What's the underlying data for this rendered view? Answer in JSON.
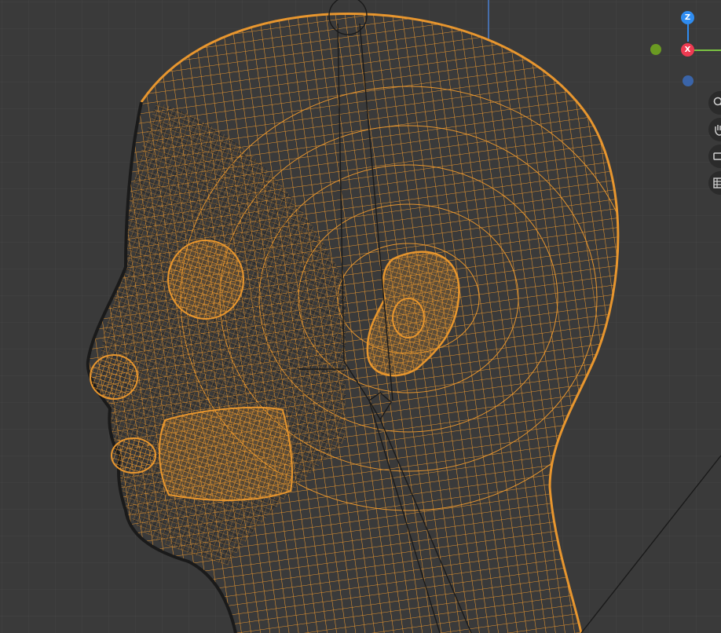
{
  "viewport": {
    "background_color": "#3a3a3a",
    "grid_color": "#464646",
    "wire_color": "#e8962e",
    "wire_dark_color": "#1e1e1e",
    "axis_line_color": "#4a7fd0"
  },
  "gizmo": {
    "z_label": "Z",
    "x_label": "X",
    "z_color": "#2f8cf0",
    "x_color": "#ee3b52",
    "y_color": "#6a9a22",
    "neg_z_color": "#3a64a8"
  },
  "tools": [
    {
      "icon": "zoom-magnifier-icon"
    },
    {
      "icon": "pan-hand-icon"
    },
    {
      "icon": "camera-view-icon"
    },
    {
      "icon": "grid-view-icon"
    }
  ]
}
